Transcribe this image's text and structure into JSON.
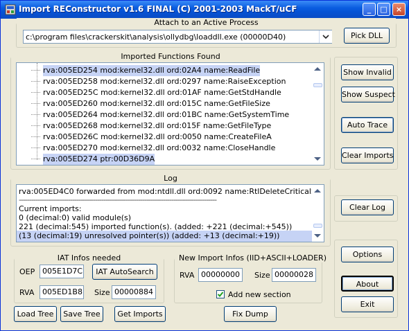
{
  "window": {
    "title": "Import REConstructor v1.6 FINAL (C) 2001-2003 MackT/uCF"
  },
  "attach": {
    "legend": "Attach to an Active Process",
    "process_value": "c:\\program files\\crackerskit\\analysis\\ollydbg\\loaddll.exe (00000D40)",
    "pick_dll_label": "Pick DLL"
  },
  "imported": {
    "legend": "Imported Functions Found",
    "rows": [
      "rva:005ED254 mod:kernel32.dll ord:02A4 name:ReadFile",
      "rva:005ED258 mod:kernel32.dll ord:0297 name:RaiseException",
      "rva:005ED25C mod:kernel32.dll ord:01AF name:GetStdHandle",
      "rva:005ED260 mod:kernel32.dll ord:015C name:GetFileSize",
      "rva:005ED264 mod:kernel32.dll ord:01BC name:GetSystemTime",
      "rva:005ED268 mod:kernel32.dll ord:015F name:GetFileType",
      "rva:005ED26C mod:kernel32.dll ord:0050 name:CreateFileA",
      "rva:005ED270 mod:kernel32.dll ord:0032 name:CloseHandle",
      "rva:005ED274 ptr:00D36D9A"
    ]
  },
  "side_buttons": {
    "show_invalid": "Show Invalid",
    "show_suspect": "Show Suspect",
    "auto_trace": "Auto Trace",
    "clear_imports": "Clear Imports",
    "clear_log": "Clear Log",
    "options": "Options",
    "about": "About",
    "exit": "Exit"
  },
  "log": {
    "legend": "Log",
    "lines": [
      "rva:005ED4C0 forwarded from mod:ntdll.dll ord:0092 name:RtlDeleteCriticalSection",
      "------------------------------------------------------------------------------------------------",
      "Current imports:",
      "0 (decimal:0) valid module(s)",
      "221 (decimal:545) imported function(s). (added: +221 (decimal:+545))",
      "(13 (decimal:19) unresolved pointer(s)) (added: +13 (decimal:+19))"
    ]
  },
  "iat": {
    "legend": "IAT Infos needed",
    "oep_label": "OEP",
    "oep_value": "005E1D7C",
    "autosearch_label": "IAT AutoSearch",
    "rva_label": "RVA",
    "rva_value": "005ED1B8",
    "size_label": "Size",
    "size_value": "00000884"
  },
  "newimport": {
    "legend": "New Import Infos (IID+ASCII+LOADER)",
    "rva_label": "RVA",
    "rva_value": "00000000",
    "size_label": "Size",
    "size_value": "00000028",
    "add_section_label": "Add new section",
    "add_section_checked": true
  },
  "bottom": {
    "load_tree": "Load Tree",
    "save_tree": "Save Tree",
    "get_imports": "Get Imports",
    "fix_dump": "Fix Dump"
  }
}
